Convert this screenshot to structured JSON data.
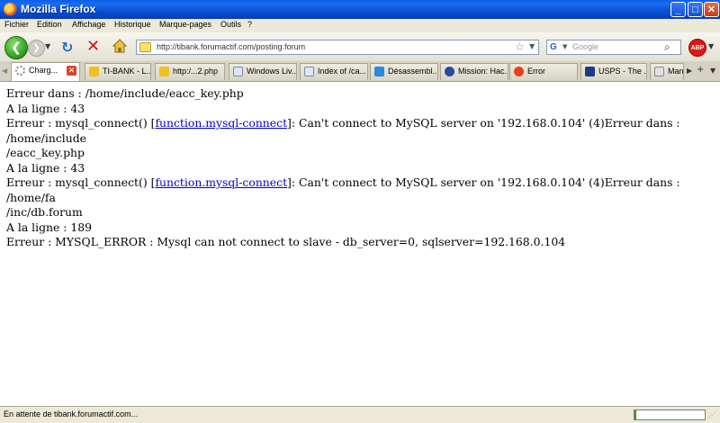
{
  "window": {
    "title": "Mozilla Firefox"
  },
  "menu": [
    "Fichier",
    "Edition",
    "Affichage",
    "Historique",
    "Marque-pages",
    "Outils",
    "?"
  ],
  "nav": {
    "url": "http://tibank.forumactif.com/posting.forum",
    "search_placeholder": "Google"
  },
  "tabs": [
    {
      "label": "Charg...",
      "active": true,
      "icon": "loading-icon",
      "icon_color": "#ffffff"
    },
    {
      "label": "TI-BANK - L...",
      "icon": "forumactif-icon",
      "icon_color": "#f0c020"
    },
    {
      "label": "http:/...2.php",
      "icon": "forumactif-icon",
      "icon_color": "#f0c020"
    },
    {
      "label": "Windows Liv...",
      "icon": "page-icon",
      "icon_color": "#dde6f5"
    },
    {
      "label": "Index of /ca...",
      "icon": "page-icon",
      "icon_color": "#dde6f5"
    },
    {
      "label": "Désassembl...",
      "icon": "twitter-icon",
      "icon_color": "#2a8ae0"
    },
    {
      "label": "Mission: Hac...",
      "icon": "site-icon",
      "icon_color": "#2a4a9a"
    },
    {
      "label": "Error",
      "icon": "error-icon",
      "icon_color": "#e84020"
    },
    {
      "label": "USPS - The ...",
      "icon": "usps-icon",
      "icon_color": "#1a3a8a"
    },
    {
      "label": "Mani",
      "icon": "page-icon",
      "icon_color": "#e0e0e0"
    }
  ],
  "content": {
    "line1": "Erreur dans : /home/include/eacc_key.php",
    "line2": "A la ligne : 43",
    "line3a": "Erreur : mysql_connect() [",
    "line3link": "function.mysql-connect",
    "line3b": "]: Can't connect to MySQL server on '192.168.0.104' (4)Erreur dans : /home/include",
    "line4": "/eacc_key.php",
    "line5": "A la ligne : 43",
    "line6a": "Erreur : mysql_connect() [",
    "line6link": "function.mysql-connect",
    "line6b": "]: Can't connect to MySQL server on '192.168.0.104' (4)Erreur dans : /home/fa",
    "line7": "/inc/db.forum",
    "line8": "A la ligne : 189",
    "line9": "Erreur : MYSQL_ERROR : Mysql can not connect to slave - db_server=0, sqlserver=192.168.0.104"
  },
  "status": {
    "text": "En attente de tibank.forumactif.com...",
    "progress": 0.02
  },
  "colors": {
    "titlebar": "#0750d6",
    "link": "#0000cc"
  }
}
